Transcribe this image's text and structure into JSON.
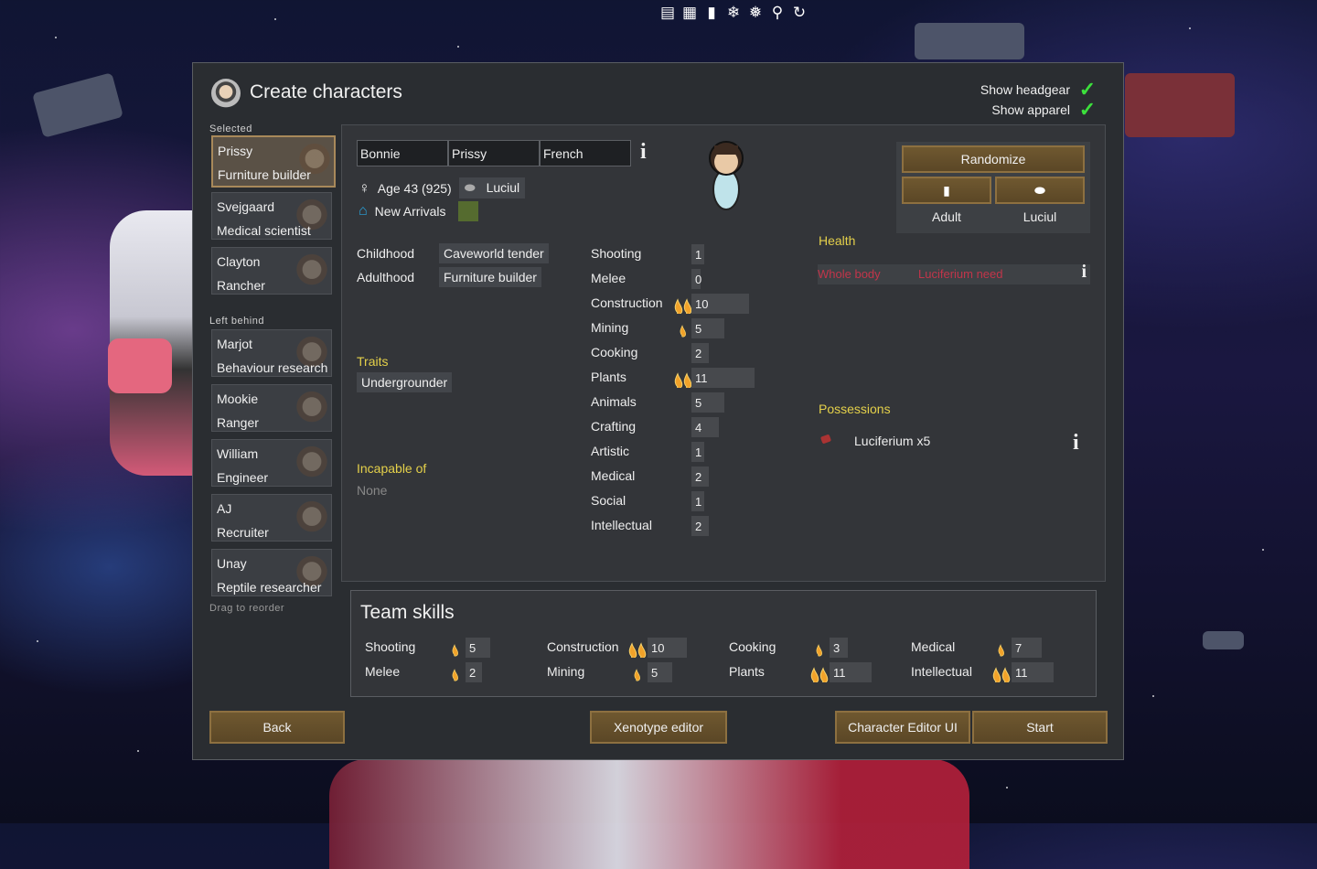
{
  "topbar_icons": [
    "list-icon",
    "table-icon",
    "pawn-icon",
    "snowflake-icon",
    "gear-snowflake-icon",
    "magnifier-icon",
    "refresh-icon"
  ],
  "dialog": {
    "title": "Create characters",
    "toggles": [
      {
        "label": "Show headgear",
        "checked": true
      },
      {
        "label": "Show apparel",
        "checked": true
      }
    ]
  },
  "sidebar": {
    "selected_label": "Selected",
    "left_behind_label": "Left behind",
    "drag_note": "Drag to reorder",
    "selected": [
      {
        "name": "Prissy",
        "job": "Furniture builder"
      },
      {
        "name": "Svejgaard",
        "job": "Medical scientist"
      },
      {
        "name": "Clayton",
        "job": "Rancher"
      }
    ],
    "left_behind": [
      {
        "name": "Marjot",
        "job": "Behaviour research"
      },
      {
        "name": "Mookie",
        "job": "Ranger"
      },
      {
        "name": "William",
        "job": "Engineer"
      },
      {
        "name": "AJ",
        "job": "Recruiter"
      },
      {
        "name": "Unay",
        "job": "Reptile researcher"
      }
    ]
  },
  "pawn": {
    "first_name": "Bonnie",
    "nick_name": "Prissy",
    "last_name": "French",
    "age": "Age 43 (925)",
    "xenotype": "Luciul",
    "faction": "New Arrivals",
    "faction_color": "#556b2f",
    "childhood_label": "Childhood",
    "childhood": "Caveworld tender",
    "adulthood_label": "Adulthood",
    "adulthood": "Furniture builder",
    "traits_label": "Traits",
    "traits": [
      "Undergrounder"
    ],
    "incapable_label": "Incapable of",
    "incapable": "None"
  },
  "skills": [
    {
      "name": "Shooting",
      "value": "1",
      "passion": 0
    },
    {
      "name": "Melee",
      "value": "0",
      "passion": 0
    },
    {
      "name": "Construction",
      "value": "10",
      "passion": 2
    },
    {
      "name": "Mining",
      "value": "5",
      "passion": 1
    },
    {
      "name": "Cooking",
      "value": "2",
      "passion": 0
    },
    {
      "name": "Plants",
      "value": "11",
      "passion": 2
    },
    {
      "name": "Animals",
      "value": "5",
      "passion": 0
    },
    {
      "name": "Crafting",
      "value": "4",
      "passion": 0
    },
    {
      "name": "Artistic",
      "value": "1",
      "passion": 0
    },
    {
      "name": "Medical",
      "value": "2",
      "passion": 0
    },
    {
      "name": "Social",
      "value": "1",
      "passion": 0
    },
    {
      "name": "Intellectual",
      "value": "2",
      "passion": 0
    }
  ],
  "randomize": {
    "button": "Randomize",
    "age_stage": "Adult",
    "xenotype": "Luciul"
  },
  "health": {
    "label": "Health",
    "part": "Whole body",
    "condition": "Luciferium need"
  },
  "possessions": {
    "label": "Possessions",
    "items": [
      "Luciferium x5"
    ]
  },
  "team": {
    "title": "Team skills",
    "skills": [
      {
        "name": "Shooting",
        "value": "5",
        "passion": 1
      },
      {
        "name": "Melee",
        "value": "2",
        "passion": 1
      },
      {
        "name": "Construction",
        "value": "10",
        "passion": 2
      },
      {
        "name": "Mining",
        "value": "5",
        "passion": 1
      },
      {
        "name": "Cooking",
        "value": "3",
        "passion": 1
      },
      {
        "name": "Plants",
        "value": "11",
        "passion": 2
      },
      {
        "name": "Medical",
        "value": "7",
        "passion": 1
      },
      {
        "name": "Intellectual",
        "value": "11",
        "passion": 2
      }
    ]
  },
  "buttons": {
    "back": "Back",
    "xenotype_editor": "Xenotype editor",
    "character_editor": "Character Editor UI",
    "start": "Start"
  },
  "colors": {
    "accent_gold": "#e4d04a",
    "health_red": "#c2354a",
    "check_green": "#3ce03c"
  }
}
